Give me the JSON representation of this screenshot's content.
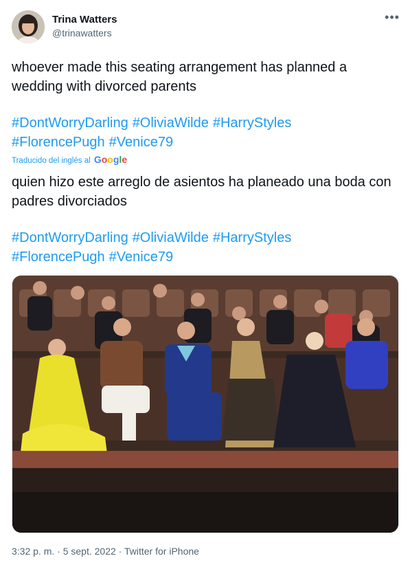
{
  "author": {
    "name": "Trina Watters",
    "handle": "@trinawatters",
    "avatar_icon": "profile-photo"
  },
  "tweet": {
    "text": "whoever made this seating arrangement has planned a wedding with divorced parents",
    "hashtags": [
      "#DontWorryDarling",
      "#OliviaWilde",
      "#HarryStyles",
      "#FlorencePugh",
      "#Venice79"
    ],
    "translated_label": "Traducido del inglés al",
    "translator_brand": "Google",
    "translation": "quien hizo este arreglo de asientos ha planeado una boda con padres divorciados",
    "translated_hashtags": [
      "#DontWorryDarling",
      "#OliviaWilde",
      "#HarryStyles",
      "#FlorencePugh",
      "#Venice79"
    ]
  },
  "meta": {
    "time": "3:32 p. m.",
    "separator1": " · ",
    "date": "5 sept. 2022",
    "separator2": " · ",
    "source": "Twitter for iPhone"
  },
  "more_icon": "more-options-icon",
  "colors": {
    "link": "#1d9bf0",
    "secondary": "#536471",
    "text": "#0f1419"
  }
}
